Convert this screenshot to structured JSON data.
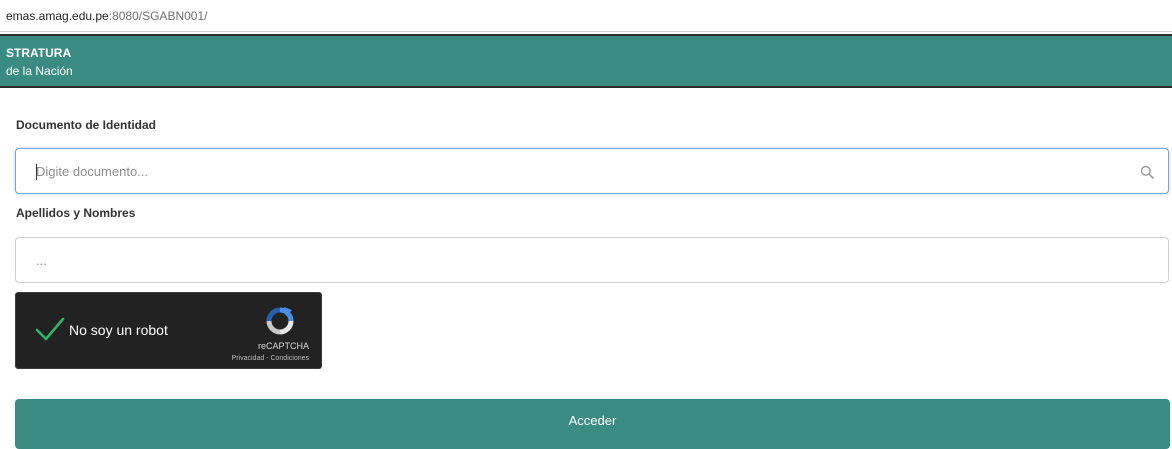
{
  "browser": {
    "url_host": "emas.amag.edu.pe",
    "url_path": ":8080/SGABN001/"
  },
  "banner": {
    "line1": "STRATURA",
    "line2": "de la Nación",
    "color": "#3a8c83"
  },
  "form": {
    "document_label": "Documento de Identidad",
    "document_placeholder": "Digite documento...",
    "document_icon": "search-icon",
    "name_label": "Apellidos y Nombres",
    "name_value": "...",
    "submit_label": "Acceder"
  },
  "captcha": {
    "checked": true,
    "label": "No soy un robot",
    "brand": "reCAPTCHA",
    "privacy": "Privacidad",
    "separator": " - ",
    "terms": "Condiciones"
  }
}
